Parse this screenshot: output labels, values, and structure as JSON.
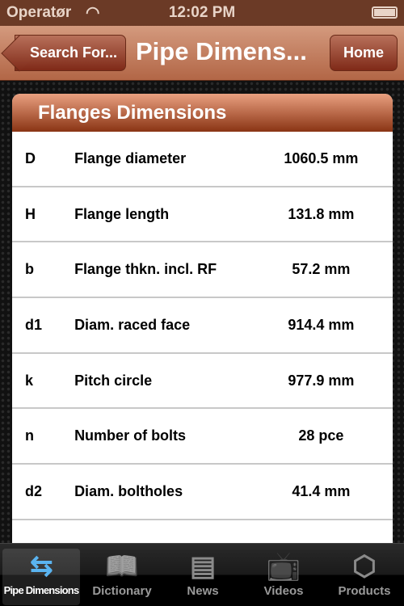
{
  "status": {
    "carrier": "Operatør",
    "time": "12:02 PM"
  },
  "nav": {
    "back_label": "Search For...",
    "title": "Pipe Dimens...",
    "home_label": "Home"
  },
  "section": {
    "title": "Flanges Dimensions",
    "rows": [
      {
        "symbol": "D",
        "label": "Flange diameter",
        "value": "1060.5 mm"
      },
      {
        "symbol": "H",
        "label": "Flange length",
        "value": "131.8 mm"
      },
      {
        "symbol": "b",
        "label": "Flange thkn. incl. RF",
        "value": "57.2 mm"
      },
      {
        "symbol": "d1",
        "label": "Diam. raced face",
        "value": "914.4 mm"
      },
      {
        "symbol": "k",
        "label": "Pitch circle",
        "value": "977.9 mm"
      },
      {
        "symbol": "n",
        "label": "Number of bolts",
        "value": "28 pce"
      },
      {
        "symbol": "d2",
        "label": "Diam. boltholes",
        "value": "41.4 mm"
      }
    ]
  },
  "tabs": [
    {
      "label": "Pipe Dimensions",
      "icon": "sync-arrows-icon",
      "active": true
    },
    {
      "label": "Dictionary",
      "icon": "book-icon"
    },
    {
      "label": "News",
      "icon": "newspaper-icon"
    },
    {
      "label": "Videos",
      "icon": "tv-icon"
    },
    {
      "label": "Products",
      "icon": "box-icon"
    }
  ]
}
